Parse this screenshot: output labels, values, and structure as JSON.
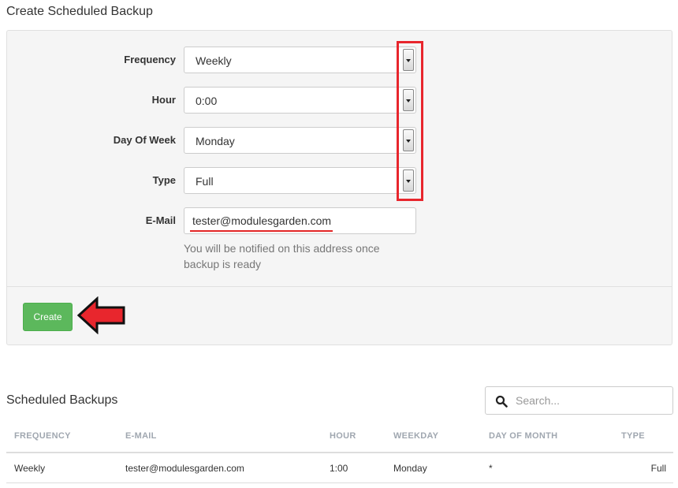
{
  "page_title": "Create Scheduled Backup",
  "form": {
    "frequency": {
      "label": "Frequency",
      "value": "Weekly"
    },
    "hour": {
      "label": "Hour",
      "value": "0:00"
    },
    "day_of_week": {
      "label": "Day Of Week",
      "value": "Monday"
    },
    "type": {
      "label": "Type",
      "value": "Full"
    },
    "email": {
      "label": "E-Mail",
      "value": "tester@modulesgarden.com",
      "help": "You will be notified on this address once backup is ready"
    },
    "create_label": "Create"
  },
  "scheduled": {
    "title": "Scheduled Backups",
    "search_placeholder": "Search...",
    "columns": [
      "FREQUENCY",
      "E-MAIL",
      "HOUR",
      "WEEKDAY",
      "DAY OF MONTH",
      "TYPE"
    ],
    "rows": [
      [
        "Weekly",
        "tester@modulesgarden.com",
        "1:00",
        "Monday",
        "*",
        "Full"
      ]
    ]
  },
  "colors": {
    "accent_green": "#5cb85c",
    "highlight_red": "#e8262d"
  },
  "icons": {
    "search": "search-icon",
    "dropdown": "chevron-down-icon",
    "pointer_arrow": "left-arrow-icon"
  }
}
